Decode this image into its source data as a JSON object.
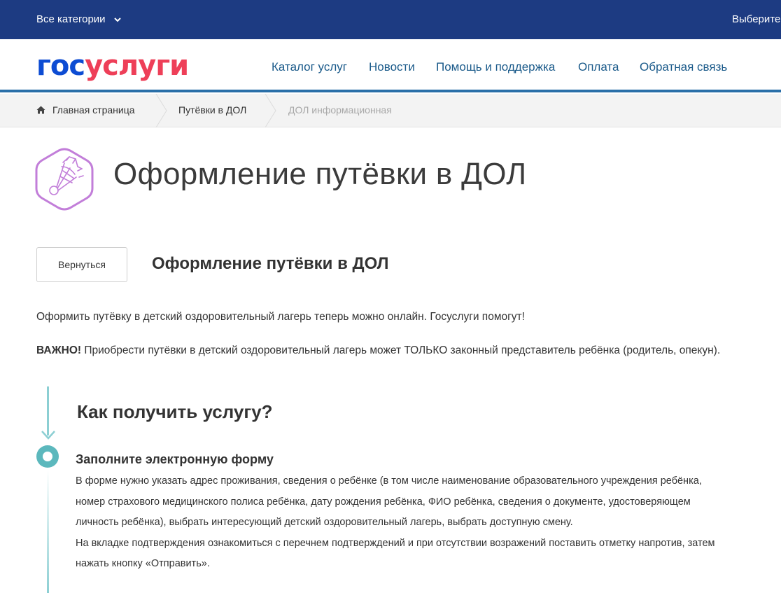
{
  "topbar": {
    "categories_label": "Все категории",
    "region_label": "Выберите"
  },
  "logo": {
    "part1": "гос",
    "part2": "услуги"
  },
  "nav": [
    "Каталог услуг",
    "Новости",
    "Помощь и поддержка",
    "Оплата",
    "Обратная связь"
  ],
  "breadcrumbs": [
    "Главная страница",
    "Путёвки в ДОЛ",
    "ДОЛ информационная"
  ],
  "page": {
    "title": "Оформление путёвки в ДОЛ",
    "back_label": "Вернуться",
    "subtitle": "Оформление путёвки в ДОЛ",
    "intro": "Оформить путёвку в детский оздоровительный лагерь теперь можно онлайн. Госуслуги помогут!",
    "important_label": "ВАЖНО!",
    "important_text": " Приобрести путёвки в детский оздоровительный лагерь может ТОЛЬКО законный представитель ребёнка (родитель, опекун)."
  },
  "how": {
    "title": "Как получить услугу?",
    "step1_title": "Заполните электронную форму",
    "step1_lines": [
      "В форме нужно указать адрес проживания, сведения о ребёнке (в том числе наименование образовательного учреждения ребёнка,",
      "номер страхового медицинского полиса ребёнка, дату рождения ребёнка, ФИО ребёнка, сведения о документе, удостоверяющем",
      "личность ребёнка), выбрать интересующий детский оздоровительный лагерь, выбрать доступную смену.",
      "На вкладке подтверждения ознакомиться с перечнем подтверждений и при отсутствии возражений поставить отметку напротив, затем",
      "нажать кнопку «Отправить»."
    ]
  },
  "colors": {
    "topbar": "#1d3b82",
    "logo_blue": "#0d4cd3",
    "logo_red": "#ee3f58",
    "accent": "#5cb8bd",
    "icon": "#c27ed9"
  },
  "icons": [
    "chevron-down-icon",
    "home-icon",
    "shuttlecock-icon"
  ]
}
